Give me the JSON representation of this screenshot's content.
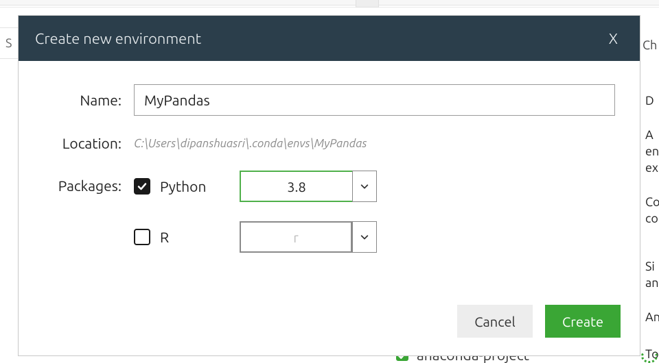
{
  "dialog": {
    "title": "Create new environment",
    "close_glyph": "X",
    "name_label": "Name:",
    "name_value": "MyPandas",
    "location_label": "Location:",
    "location_value": "C:\\Users\\dipanshuasri\\.conda\\envs\\MyPandas",
    "packages_label": "Packages:",
    "python": {
      "label": "Python",
      "checked": true,
      "version": "3.8"
    },
    "r": {
      "label": "R",
      "checked": false,
      "version": "r"
    },
    "cancel_label": "Cancel",
    "create_label": "Create"
  },
  "background": {
    "search_initial": "S",
    "right_tab": "Ch",
    "side_fragments": [
      "D",
      "A",
      "en",
      "ex",
      "Co",
      "co",
      "Si",
      "an",
      "An",
      "To"
    ],
    "bottom_item": "anaconda-project"
  }
}
